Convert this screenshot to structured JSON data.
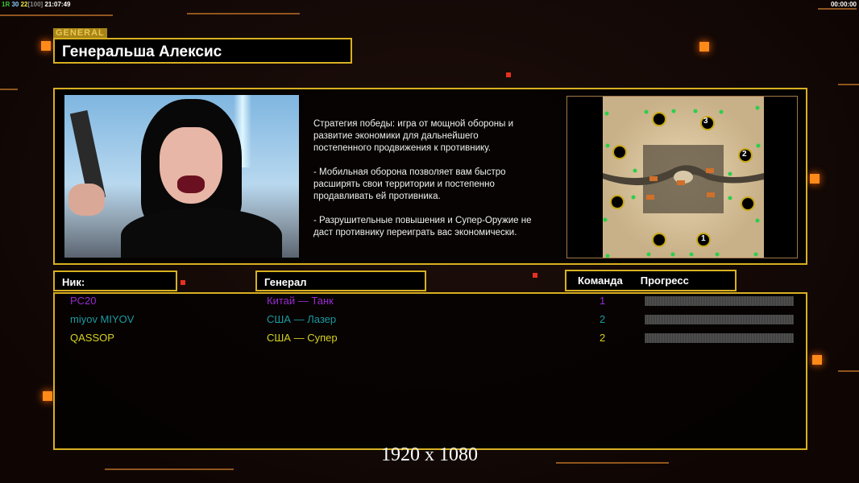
{
  "hud": {
    "left_prefix": "1R",
    "left_a": "30",
    "left_b": "22",
    "left_c": "[100]",
    "time": "21:07:49",
    "right_time": "00:00:00"
  },
  "general": {
    "tag": "GENERAL",
    "name": "Генеральша Алексис"
  },
  "description": [
    "Стратегия победы: игра от мощной обороны и\n развитие экономики для дальнейшего\n постепенного продвижения к противнику.",
    "- Мобильная оборона позволяет вам быстро\n расширять свои территории и постепенно\n продавливать ей противника.",
    "- Разрушительные повышения и Супер-Оружие не\n даст противнику переиграть вас экономически."
  ],
  "map": {
    "spawn_labels": [
      "1",
      "2",
      "3"
    ]
  },
  "table": {
    "headers": {
      "nick": "Ник:",
      "general": "Генерал",
      "team": "Команда",
      "progress": "Прогресс"
    },
    "rows": [
      {
        "nick": "PC20",
        "general": "Китай — Танк",
        "team": "1",
        "color": "#9a2ad0",
        "progress": 0
      },
      {
        "nick": "miyov MIYOV",
        "general": "США — Лазер",
        "team": "2",
        "color": "#1a9aa0",
        "progress": 0
      },
      {
        "nick": "QASSOP",
        "general": "США — Супер",
        "team": "2",
        "color": "#d8d020",
        "progress": 0
      }
    ]
  },
  "resolution": "1920 x 1080",
  "colors": {
    "accent": "#d8b020",
    "orange": "#ff8a1a"
  }
}
